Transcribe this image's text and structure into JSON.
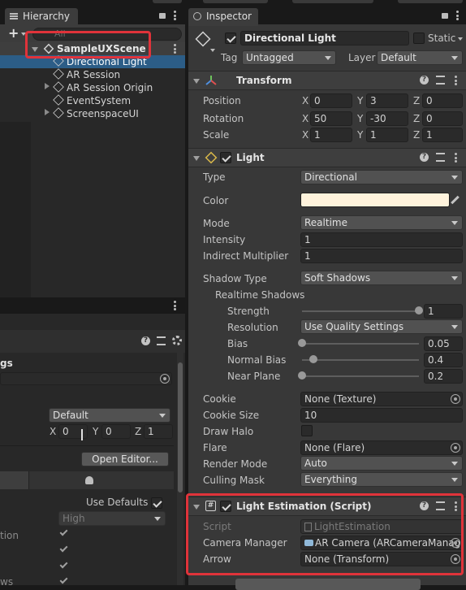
{
  "colors": {
    "accent": "#e0333a",
    "selection": "#2c5d87",
    "light_color": "#fff3dc"
  },
  "hierarchy": {
    "tab_label": "Hierarchy",
    "add_label": "+",
    "search_placeholder": "All",
    "scene_name": "SampleUXScene",
    "items": [
      {
        "label": "Directional Light"
      },
      {
        "label": "AR Session"
      },
      {
        "label": "AR Session Origin"
      },
      {
        "label": "EventSystem"
      },
      {
        "label": "ScreenspaceUI"
      }
    ]
  },
  "lower_panel": {
    "section_label": "gs",
    "dropdown_value": "Default",
    "x_label": "X",
    "x_value": "0",
    "y_label": "Y",
    "y_value": "0",
    "z_label": "Z",
    "z_value": "1",
    "open_editor_label": "Open Editor...",
    "use_defaults_label": "Use Defaults",
    "quality_value": "High",
    "row_labels": [
      "tion",
      "ws"
    ]
  },
  "inspector": {
    "tab_label": "Inspector",
    "object_name": "Directional Light",
    "static_label": "Static",
    "tag_label": "Tag",
    "tag_value": "Untagged",
    "layer_label": "Layer",
    "layer_value": "Default",
    "transform": {
      "title": "Transform",
      "position_label": "Position",
      "position": {
        "x": "0",
        "y": "3",
        "z": "0"
      },
      "rotation_label": "Rotation",
      "rotation": {
        "x": "50",
        "y": "-30",
        "z": "0"
      },
      "scale_label": "Scale",
      "scale": {
        "x": "1",
        "y": "1",
        "z": "1"
      },
      "axis_x": "X",
      "axis_y": "Y",
      "axis_z": "Z"
    },
    "light": {
      "title": "Light",
      "type_label": "Type",
      "type_value": "Directional",
      "color_label": "Color",
      "mode_label": "Mode",
      "mode_value": "Realtime",
      "intensity_label": "Intensity",
      "intensity_value": "1",
      "indirect_label": "Indirect Multiplier",
      "indirect_value": "1",
      "shadow_type_label": "Shadow Type",
      "shadow_type_value": "Soft Shadows",
      "realtime_shadows_label": "Realtime Shadows",
      "strength_label": "Strength",
      "strength_value": "1",
      "strength_level": 1.0,
      "resolution_label": "Resolution",
      "resolution_value": "Use Quality Settings",
      "bias_label": "Bias",
      "bias_value": "0.05",
      "bias_level": 0.0,
      "normal_bias_label": "Normal Bias",
      "normal_bias_value": "0.4",
      "normal_bias_level": 0.1,
      "near_plane_label": "Near Plane",
      "near_plane_value": "0.2",
      "near_plane_level": 0.0,
      "cookie_label": "Cookie",
      "cookie_value": "None (Texture)",
      "cookie_size_label": "Cookie Size",
      "cookie_size_value": "10",
      "draw_halo_label": "Draw Halo",
      "flare_label": "Flare",
      "flare_value": "None (Flare)",
      "render_mode_label": "Render Mode",
      "render_mode_value": "Auto",
      "culling_mask_label": "Culling Mask",
      "culling_mask_value": "Everything"
    },
    "light_estimation": {
      "title": "Light Estimation (Script)",
      "script_label": "Script",
      "script_value": "LightEstimation",
      "camera_manager_label": "Camera Manager",
      "camera_manager_value": "AR Camera (ARCameraManag",
      "arrow_label": "Arrow",
      "arrow_value": "None (Transform)"
    }
  }
}
